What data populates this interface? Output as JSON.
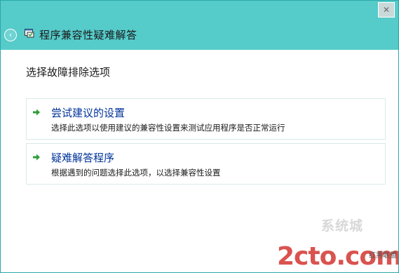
{
  "window": {
    "title": "程序兼容性疑难解答",
    "close_label": "✕",
    "back_label": "‹"
  },
  "heading": "选择故障排除选项",
  "options": [
    {
      "title": "尝试建议的设置",
      "description": "选择此选项以使用建议的兼容性设置来测试应用程序是否正常运行"
    },
    {
      "title": "疑难解答程序",
      "description": "根据遇到的问题选择此选项，以选择兼容性设置"
    }
  ],
  "watermark": {
    "logo_text": "系统城",
    "domain_text": "2cto.com",
    "brand_text": "红黑联盟"
  },
  "colors": {
    "titlebar": "#55cbca",
    "link": "#003399",
    "arrow": "#2e9e3a",
    "watermark_domain": "#d9534f"
  }
}
